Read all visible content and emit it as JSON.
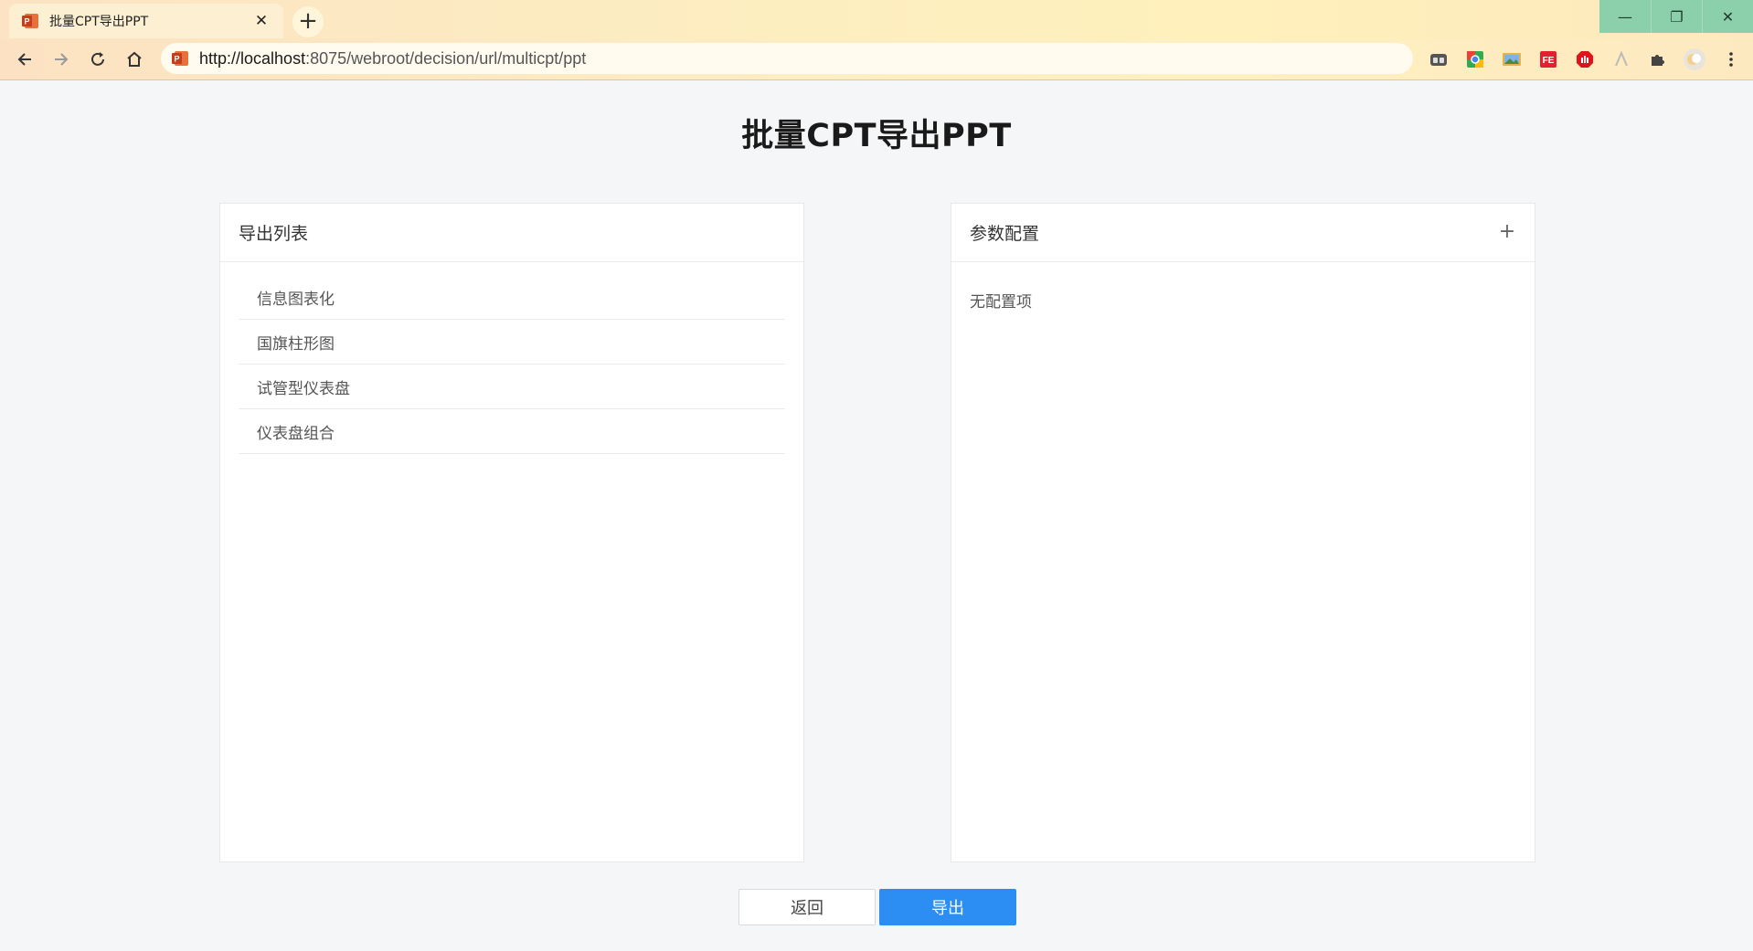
{
  "browser": {
    "tab": {
      "title": "批量CPT导出PPT",
      "icon": "powerpoint-icon"
    },
    "new_tab_label": "+",
    "window_controls": {
      "minimize": "—",
      "restore": "❐",
      "close": "✕"
    },
    "url_prefix": "http://localhost",
    "url_rest": ":8075/webroot/decision/url/multicpt/ppt",
    "extensions": [
      "tab-manager-icon",
      "chrome-store-icon",
      "image-extension-icon",
      "fe-extension-icon",
      "adblock-icon",
      "text-extension-icon",
      "puzzle-extensions-icon",
      "profile-avatar-icon",
      "kebab-menu-icon"
    ]
  },
  "page": {
    "title": "批量CPT导出PPT",
    "export_panel": {
      "header": "导出列表",
      "items": [
        "信息图表化",
        "国旗柱形图",
        "试管型仪表盘",
        "仪表盘组合"
      ]
    },
    "param_panel": {
      "header": "参数配置",
      "add_label": "+",
      "empty_text": "无配置项"
    },
    "buttons": {
      "back": "返回",
      "export": "导出"
    }
  },
  "colors": {
    "primary": "#2c8df2",
    "background": "#f5f6f8",
    "window_controls": "#8ccfab"
  }
}
